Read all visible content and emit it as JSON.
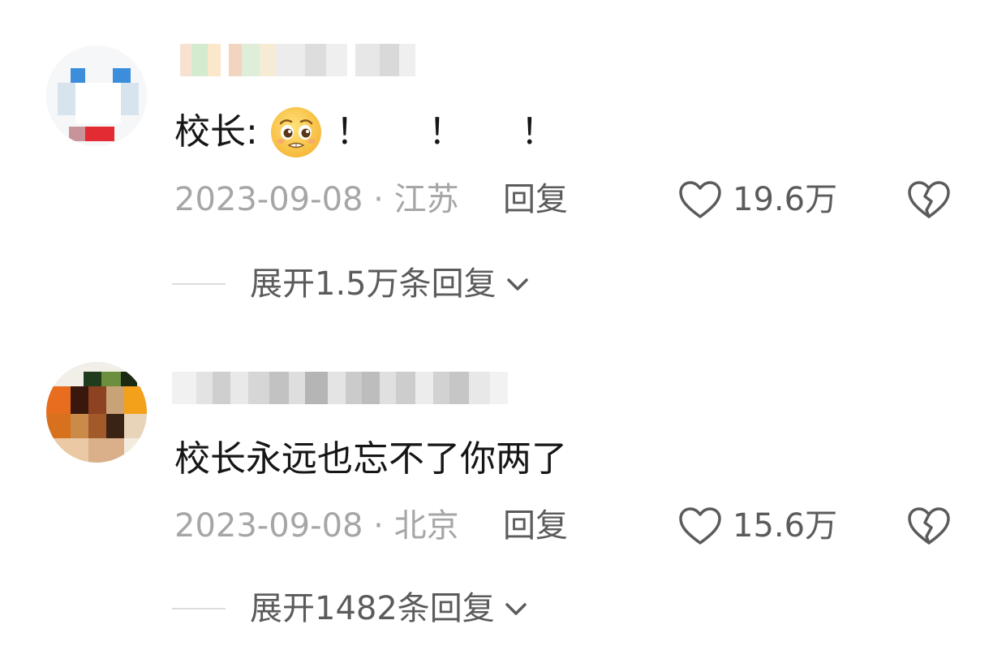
{
  "comments": [
    {
      "text_prefix": "校长:",
      "emoji": "pleading-face-emoji",
      "text_suffix": "！ ！ ！",
      "date": "2023-09-08",
      "location": "江苏",
      "reply_label": "回复",
      "like_count": "19.6万",
      "expand_label": "展开1.5万条回复"
    },
    {
      "text": "校长永远也忘不了你两了",
      "date": "2023-09-08",
      "location": "北京",
      "reply_label": "回复",
      "like_count": "15.6万",
      "expand_label": "展开1482条回复"
    }
  ],
  "icons": {
    "like": "heart-outline-icon",
    "dislike": "broken-heart-icon",
    "expand": "chevron-down-icon"
  },
  "colors": {
    "text_primary": "#161616",
    "text_secondary": "#5b5b5b",
    "text_muted": "#a6a6a6",
    "divider": "#dcdcdc"
  }
}
